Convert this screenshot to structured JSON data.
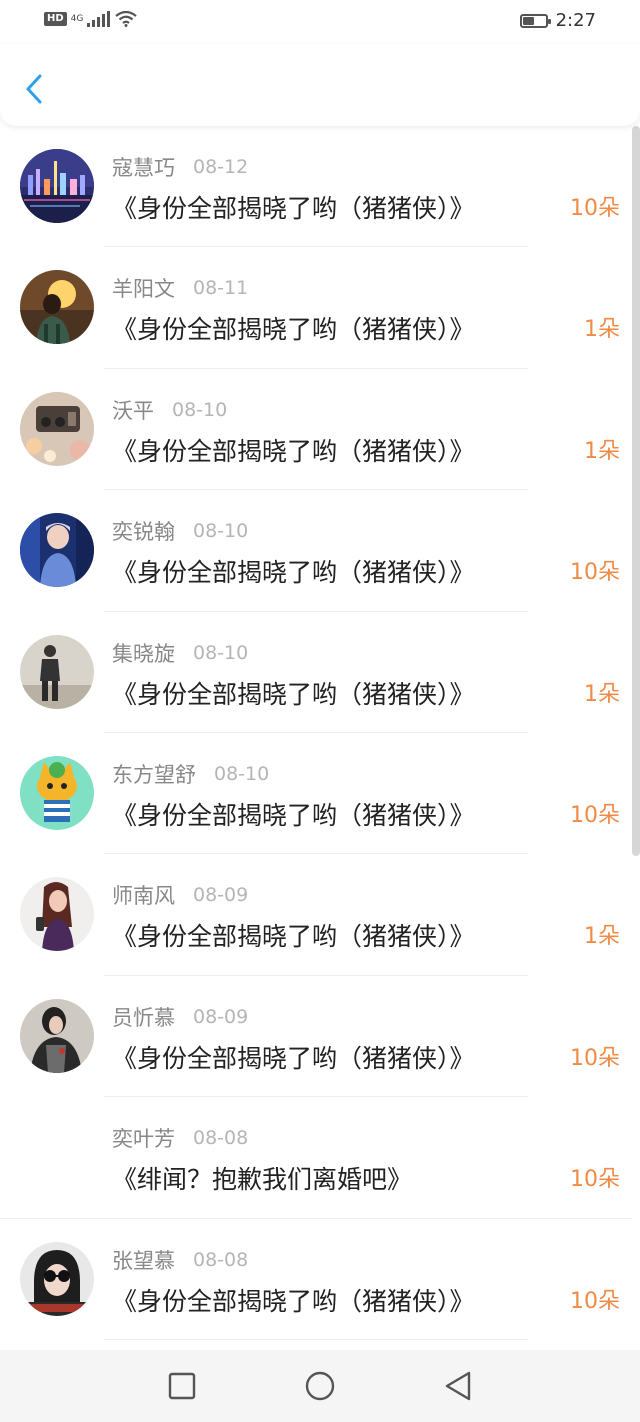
{
  "status_bar": {
    "hd": "HD",
    "network": "4G",
    "time": "2:27",
    "battery_level": 0.5
  },
  "header": {
    "back_icon": "chevron-left-icon",
    "accent_color": "#2ba0ef"
  },
  "list": {
    "items": [
      {
        "name": "寇慧巧",
        "date": "08-12",
        "book": "《身份全部揭晓了哟（猪猪侠）》",
        "count": "10朵",
        "avatar": "city-night"
      },
      {
        "name": "羊阳文",
        "date": "08-11",
        "book": "《身份全部揭晓了哟（猪猪侠）》",
        "count": "1朵",
        "avatar": "sunset-person"
      },
      {
        "name": "沃平",
        "date": "08-10",
        "book": "《身份全部揭晓了哟（猪猪侠）》",
        "count": "1朵",
        "avatar": "radio-bokeh"
      },
      {
        "name": "奕锐翰",
        "date": "08-10",
        "book": "《身份全部揭晓了哟（猪猪侠）》",
        "count": "10朵",
        "avatar": "blue-portrait"
      },
      {
        "name": "集晓旋",
        "date": "08-10",
        "book": "《身份全部揭晓了哟（猪猪侠）》",
        "count": "1朵",
        "avatar": "street-walker"
      },
      {
        "name": "东方望舒",
        "date": "08-10",
        "book": "《身份全部揭晓了哟（猪猪侠）》",
        "count": "10朵",
        "avatar": "cartoon-cat"
      },
      {
        "name": "师南风",
        "date": "08-09",
        "book": "《身份全部揭晓了哟（猪猪侠）》",
        "count": "1朵",
        "avatar": "girl-portrait"
      },
      {
        "name": "员忻慕",
        "date": "08-09",
        "book": "《身份全部揭晓了哟（猪猪侠）》",
        "count": "10朵",
        "avatar": "dark-jacket"
      },
      {
        "name": "奕叶芳",
        "date": "08-08",
        "book": "《绯闻？抱歉我们离婚吧》",
        "count": "10朵",
        "avatar": "none"
      },
      {
        "name": "张望慕",
        "date": "08-08",
        "book": "《身份全部揭晓了哟（猪猪侠）》",
        "count": "10朵",
        "avatar": "sunglasses-girl"
      }
    ]
  },
  "colors": {
    "count": "#f08a45",
    "name": "#888888",
    "date": "#b5b5b5",
    "book": "#222222"
  },
  "nav_bar": {
    "icons": [
      "square-icon",
      "circle-icon",
      "triangle-back-icon"
    ]
  }
}
